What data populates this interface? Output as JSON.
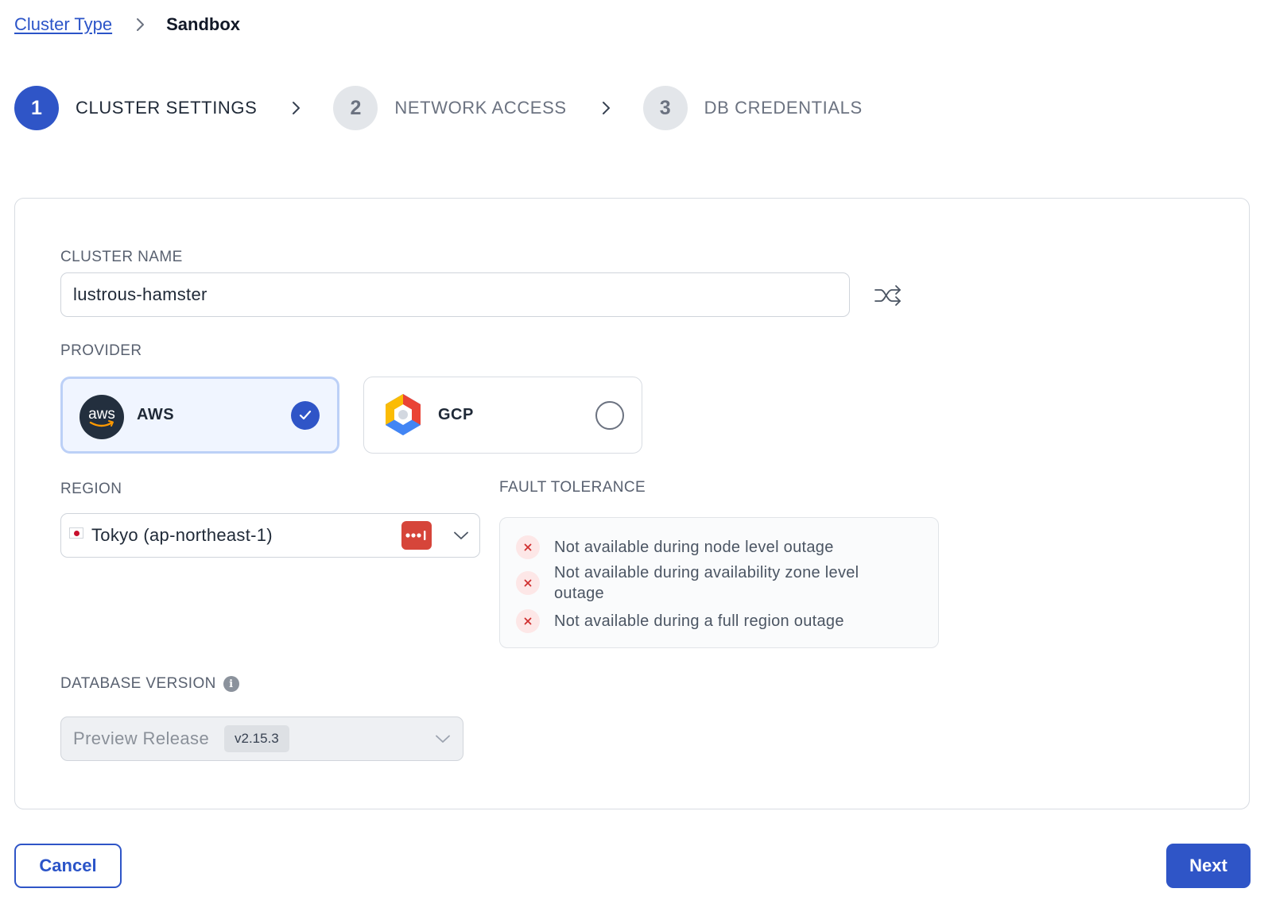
{
  "breadcrumb": {
    "parent": "Cluster Type",
    "current": "Sandbox"
  },
  "stepper": {
    "steps": [
      {
        "number": "1",
        "label": "CLUSTER SETTINGS",
        "state": "active"
      },
      {
        "number": "2",
        "label": "NETWORK ACCESS",
        "state": "inactive"
      },
      {
        "number": "3",
        "label": "DB CREDENTIALS",
        "state": "inactive"
      }
    ]
  },
  "form": {
    "cluster_name": {
      "label": "CLUSTER NAME",
      "value": "lustrous-hamster",
      "shuffle_icon": "shuffle-icon"
    },
    "provider": {
      "label": "PROVIDER",
      "options": [
        {
          "name": "AWS",
          "selected": true,
          "logo_text": "aws"
        },
        {
          "name": "GCP",
          "selected": false
        }
      ]
    },
    "region": {
      "label": "REGION",
      "value": "Tokyo (ap-northeast-1)",
      "flag": "japan-flag-icon"
    },
    "fault_tolerance": {
      "label": "FAULT TOLERANCE",
      "items": [
        "Not available during node level outage",
        "Not available during availability zone level outage",
        "Not available during a full region outage"
      ]
    },
    "database_version": {
      "label": "DATABASE VERSION",
      "value": "Preview Release",
      "tag": "v2.15.3",
      "info_icon_glyph": "i"
    }
  },
  "footer": {
    "cancel_label": "Cancel",
    "next_label": "Next"
  },
  "colors": {
    "primary": "#2f55c7",
    "selected_bg": "#f0f5ff",
    "error_red": "#d03030"
  }
}
